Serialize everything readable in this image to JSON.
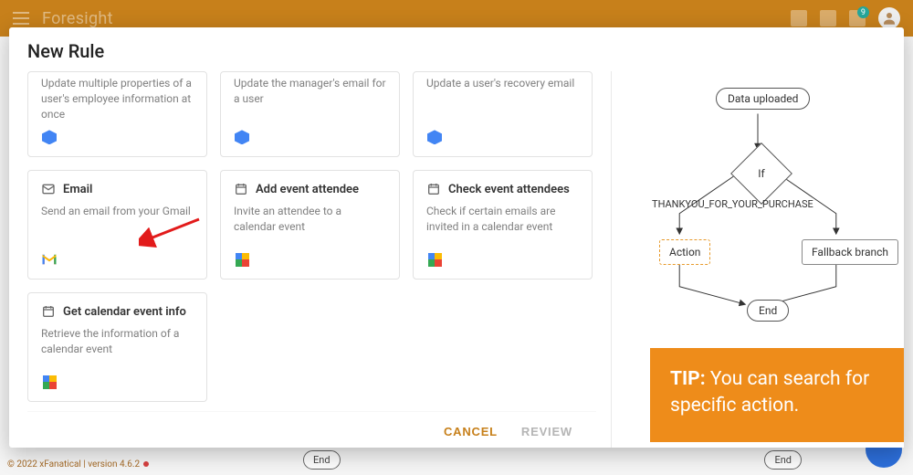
{
  "app": {
    "name": "Foresight",
    "notification_count": "9",
    "copyright": "© 2022 xFanatical | version 4.6.2"
  },
  "canvas": {
    "end_label_1": "End",
    "end_label_2": "End"
  },
  "modal": {
    "title": "New Rule",
    "cancel": "CANCEL",
    "review": "REVIEW"
  },
  "cards": [
    {
      "title": "",
      "desc": "Update multiple properties of a user's employee information at once",
      "provider": "admin",
      "short": true,
      "title_icon": ""
    },
    {
      "title": "",
      "desc": "Update the manager's email for a user",
      "provider": "admin",
      "short": true,
      "title_icon": ""
    },
    {
      "title": "",
      "desc": "Update a user's recovery email",
      "provider": "admin",
      "short": true,
      "title_icon": ""
    },
    {
      "title": "Email",
      "desc": "Send an email from your Gmail",
      "provider": "gmail",
      "short": false,
      "title_icon": "mail"
    },
    {
      "title": "Add event attendee",
      "desc": "Invite an attendee to a calendar event",
      "provider": "calendar",
      "short": false,
      "title_icon": "calendar"
    },
    {
      "title": "Check event attendees",
      "desc": "Check if certain emails are invited in a calendar event",
      "provider": "calendar",
      "short": false,
      "title_icon": "calendar"
    },
    {
      "title": "Get calendar event info",
      "desc": "Retrieve the information of a calendar event",
      "provider": "calendar",
      "short": false,
      "title_icon": "calendar"
    }
  ],
  "flow": {
    "start": "Data uploaded",
    "condition": "If",
    "branch_label": "THANKYOU_FOR_YOUR_PURCHASE",
    "action": "Action",
    "fallback": "Fallback branch",
    "end": "End"
  },
  "tip": {
    "label": "TIP:",
    "text": " You can search for specific action."
  }
}
